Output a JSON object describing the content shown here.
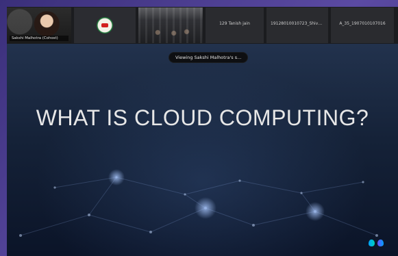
{
  "participants": [
    {
      "kind": "video",
      "name_label": "Sakshi Malhotra (Cohost)",
      "active": true
    },
    {
      "kind": "logo",
      "name_label": ""
    },
    {
      "kind": "video",
      "name_label": ""
    },
    {
      "kind": "name",
      "name_label": "129 Tanish jain"
    },
    {
      "kind": "name",
      "name_label": "19128010010723_Shivaye"
    },
    {
      "kind": "name",
      "name_label": "A_35_1907010107016"
    }
  ],
  "stage": {
    "viewing_text": "Viewing Sakshi Malhotra's s...",
    "slide_title": "WHAT IS CLOUD COMPUTING?"
  },
  "icons": {
    "brand_icon": "webex-logo"
  },
  "colors": {
    "app_purple": "#5b4aa3",
    "active_outline": "#7ad1ff"
  }
}
